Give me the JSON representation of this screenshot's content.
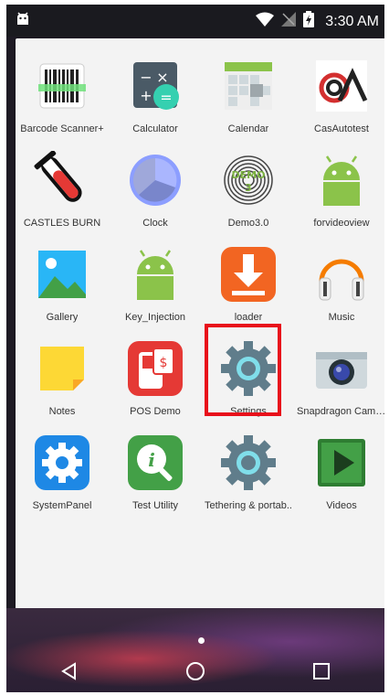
{
  "status_bar": {
    "time": "3:30 AM",
    "left_icon": "android-notification-icon",
    "icons": [
      "wifi-icon",
      "no-signal-icon",
      "battery-charging-icon"
    ]
  },
  "apps": [
    {
      "label": "Barcode Scanner+",
      "icon": "barcode-icon"
    },
    {
      "label": "Calculator",
      "icon": "calculator-icon"
    },
    {
      "label": "Calendar",
      "icon": "calendar-icon"
    },
    {
      "label": "CasAutotest",
      "icon": "castles-logo-icon"
    },
    {
      "label": "CASTLES BURN",
      "icon": "test-tube-icon"
    },
    {
      "label": "Clock",
      "icon": "clock-icon"
    },
    {
      "label": "Demo3.0",
      "icon": "fingerprint-icon",
      "icon_text": "DEMO\n3"
    },
    {
      "label": "forvideoview",
      "icon": "android-icon"
    },
    {
      "label": "Gallery",
      "icon": "gallery-icon"
    },
    {
      "label": "Key_Injection",
      "icon": "android-icon"
    },
    {
      "label": "loader",
      "icon": "download-icon"
    },
    {
      "label": "Music",
      "icon": "headphones-icon"
    },
    {
      "label": "Notes",
      "icon": "sticky-note-icon"
    },
    {
      "label": "POS Demo",
      "icon": "pos-terminal-icon"
    },
    {
      "label": "Settings",
      "icon": "gear-icon",
      "highlighted": true
    },
    {
      "label": "Snapdragon Came..",
      "icon": "camera-icon"
    },
    {
      "label": "SystemPanel",
      "icon": "gear-blue-icon"
    },
    {
      "label": "Test Utility",
      "icon": "info-magnifier-icon"
    },
    {
      "label": "Tethering & portab..",
      "icon": "gear-icon"
    },
    {
      "label": "Videos",
      "icon": "play-icon"
    }
  ],
  "highlight_color": "#e8101b",
  "nav": [
    "back-icon",
    "home-icon",
    "recents-icon"
  ]
}
